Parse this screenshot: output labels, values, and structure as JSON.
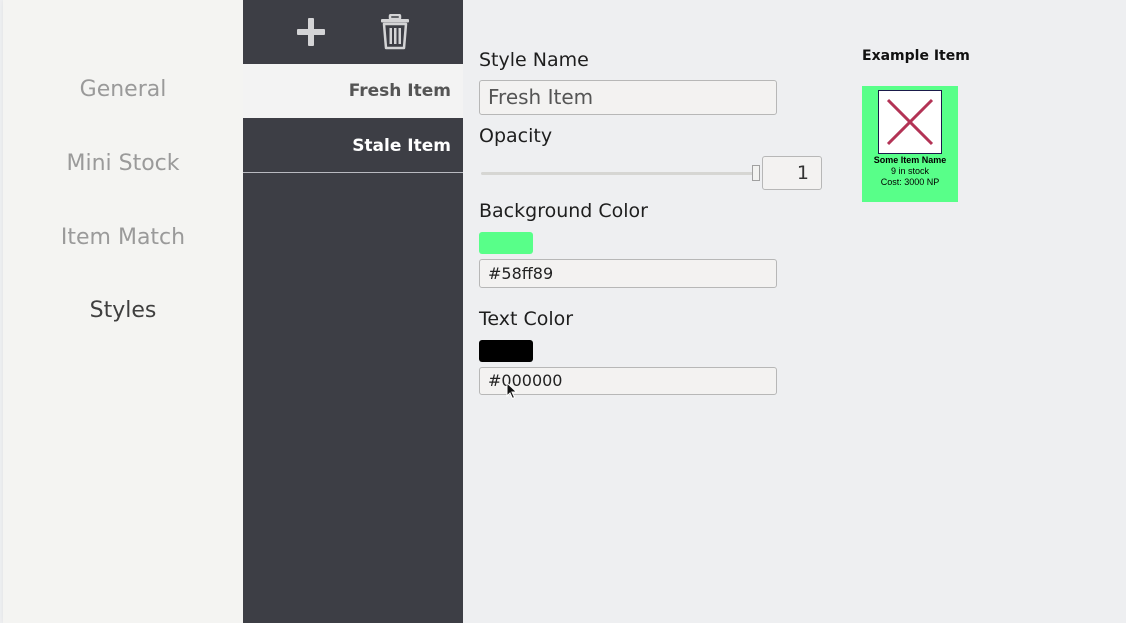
{
  "nav": {
    "items": [
      {
        "label": "General"
      },
      {
        "label": "Mini Stock"
      },
      {
        "label": "Item Match"
      },
      {
        "label": "Styles"
      }
    ],
    "active": "Styles"
  },
  "toolbar": {
    "add_icon": "plus-icon",
    "delete_icon": "trash-icon"
  },
  "styles_list": [
    {
      "label": "Fresh Item",
      "selected": true
    },
    {
      "label": "Stale Item",
      "selected": false
    }
  ],
  "form": {
    "style_name_label": "Style Name",
    "style_name_value": "Fresh Item",
    "opacity_label": "Opacity",
    "opacity_value": "1",
    "background_label": "Background Color",
    "background_value": "#58ff89",
    "text_color_label": "Text Color",
    "text_color_value": "#000000"
  },
  "preview": {
    "title": "Example Item",
    "item_name": "Some Item Name",
    "stock": "9 in stock",
    "cost": "Cost: 3000 NP",
    "background_color": "#58ff89",
    "text_color": "#000000"
  }
}
